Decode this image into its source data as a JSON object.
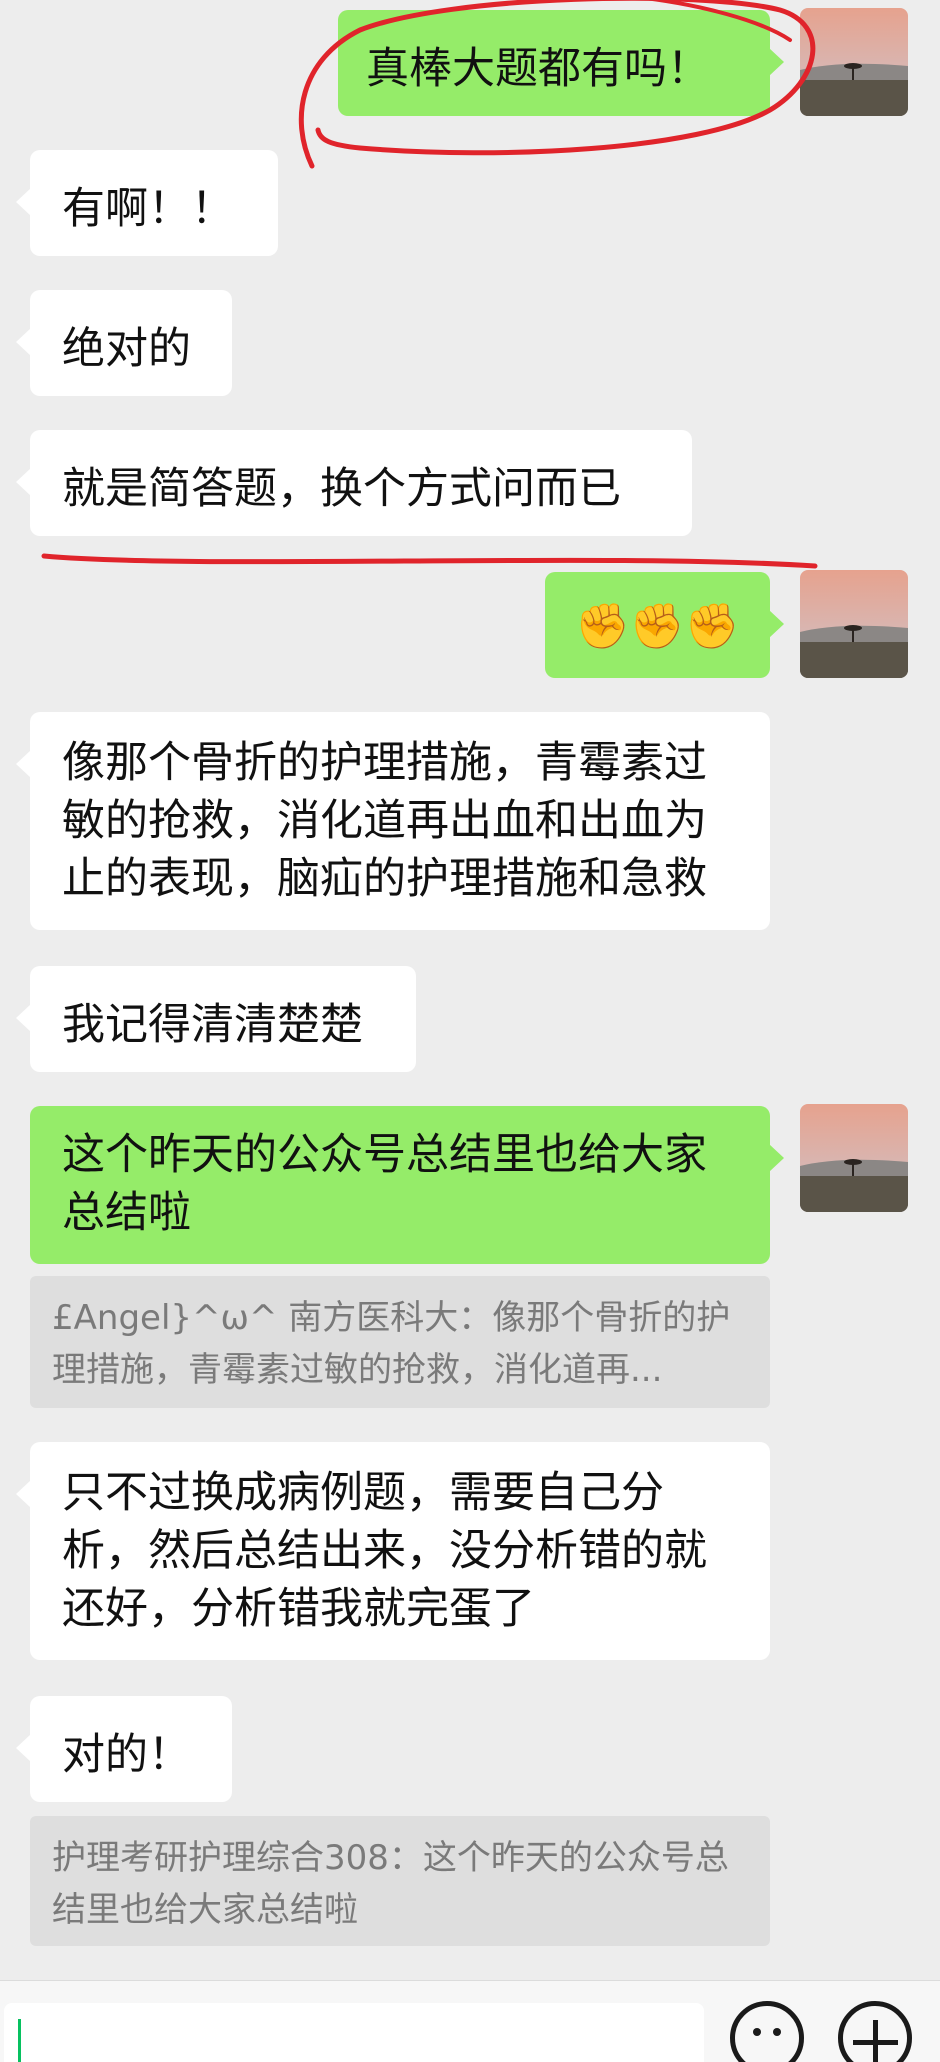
{
  "messages": [
    {
      "side": "out",
      "text": "真棒大题都有吗！"
    },
    {
      "side": "in",
      "text": "有啊！！"
    },
    {
      "side": "in",
      "text": "绝对的"
    },
    {
      "side": "in",
      "text": "就是简答题，换个方式问而已"
    },
    {
      "side": "out",
      "text": "✊✊✊"
    },
    {
      "side": "in",
      "text": "像那个骨折的护理措施，青霉素过敏的抢救，消化道再出血和出血为止的表现，脑疝的护理措施和急救"
    },
    {
      "side": "in",
      "text": "我记得清清楚楚"
    },
    {
      "side": "out",
      "text": "这个昨天的公众号总结里也给大家总结啦"
    },
    {
      "side": "quote",
      "text": "£Angel}^ω^ 南方医科大：像那个骨折的护理措施，青霉素过敏的抢救，消化道再..."
    },
    {
      "side": "in",
      "text": "只不过换成病例题，需要自己分析，然后总结出来，没分析错的就还好，分析错我就完蛋了"
    },
    {
      "side": "in",
      "text": "对的！"
    },
    {
      "side": "quote",
      "text": "护理考研护理综合308：这个昨天的公众号总结里也给大家总结啦"
    }
  ],
  "avatar_icon": "sunset-landscape-avatar",
  "input_bar": {
    "emoji_icon": "smiley-face-icon",
    "more_icon": "plus-circle-icon"
  },
  "colors": {
    "incoming_bubble": "#ffffff",
    "outgoing_bubble": "#95ec69",
    "background": "#ededed",
    "annotation": "#e0242b"
  }
}
